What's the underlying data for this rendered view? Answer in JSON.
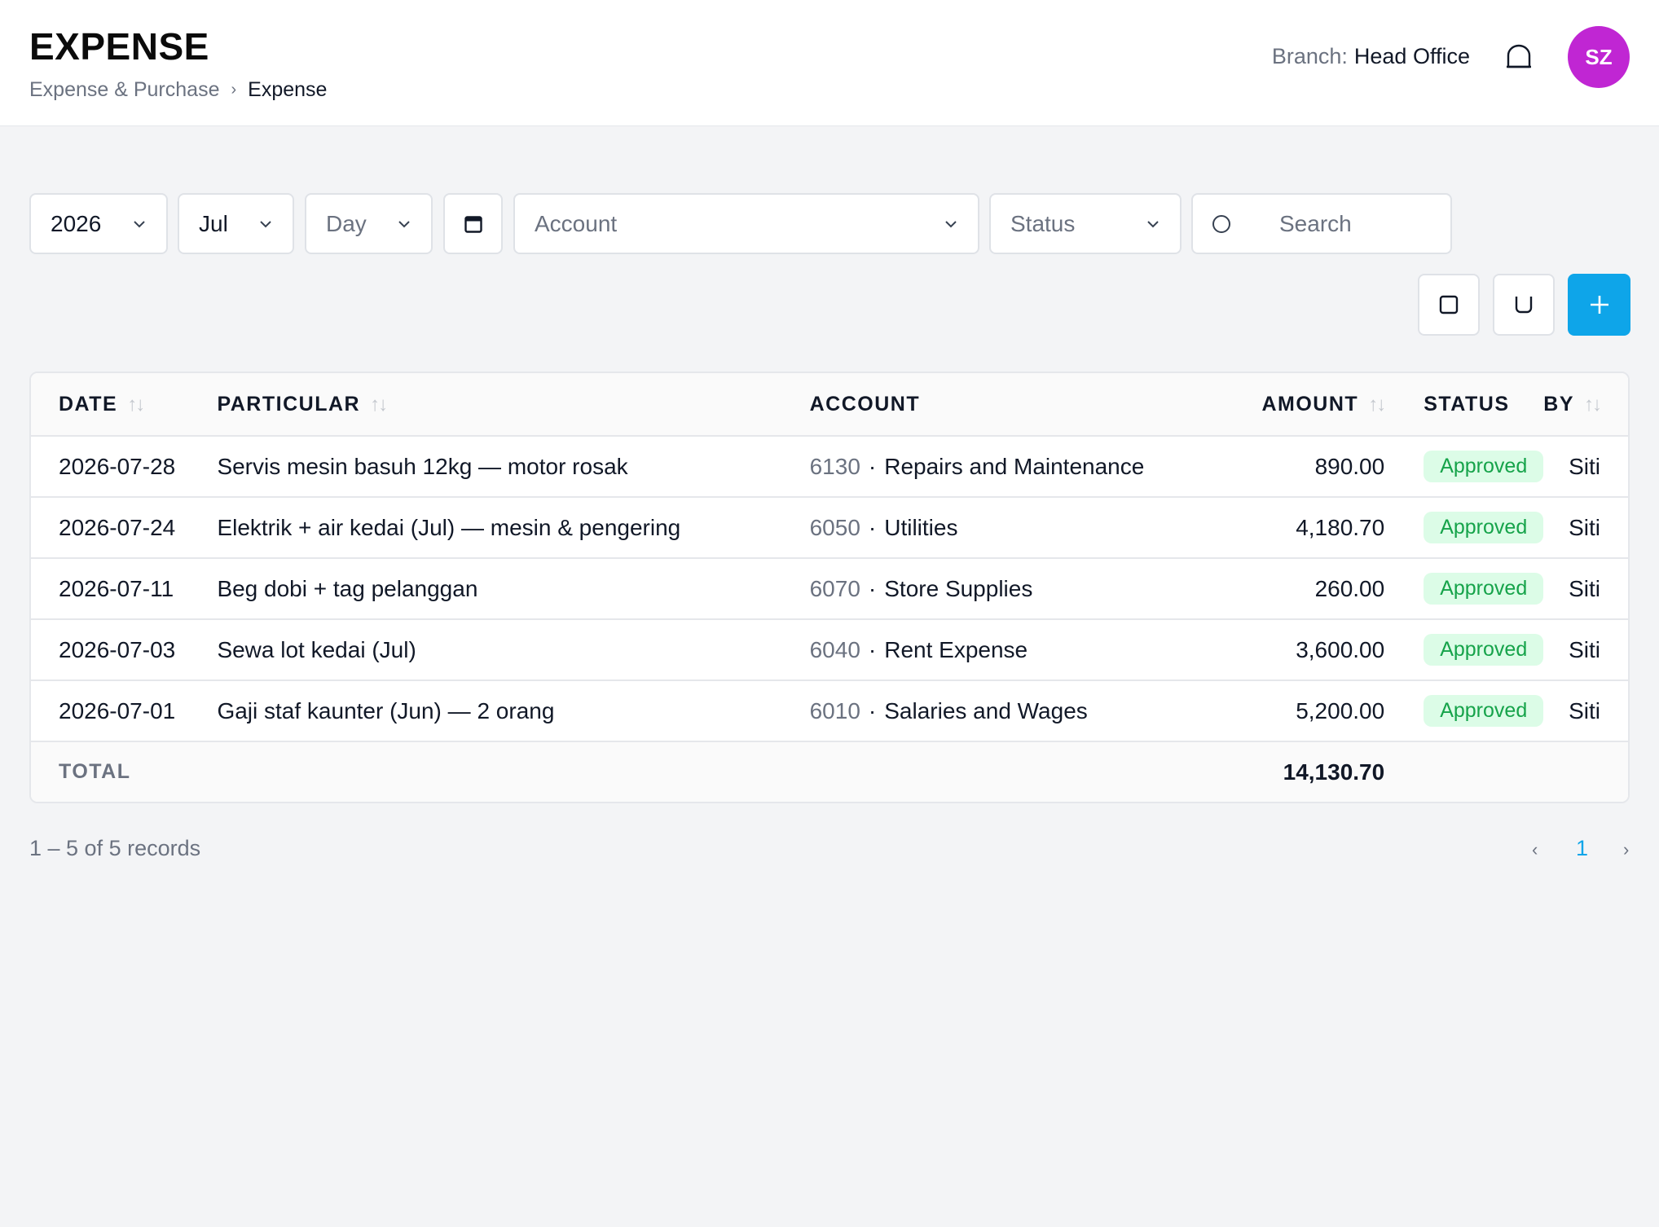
{
  "header": {
    "title": "EXPENSE",
    "breadcrumb": {
      "parent": "Expense & Purchase",
      "separator": "›",
      "current": "Expense"
    },
    "branch_label": "Branch:",
    "branch_name": "Head Office",
    "bell_icon": "bell-icon",
    "avatar_initials": "SZ",
    "avatar_color": "#c026d3"
  },
  "filters": {
    "year": "2026",
    "month": "Jul",
    "day_placeholder": "Day",
    "calendar_icon": "calendar-icon",
    "account_placeholder": "Account",
    "status_placeholder": "Status",
    "search_placeholder": "Search"
  },
  "actions": {
    "export_icon": "square-icon",
    "print_icon": "cup-icon",
    "add_icon": "plus-icon",
    "accent_color": "#0ea5e9"
  },
  "table": {
    "columns": {
      "date": "DATE",
      "particular": "PARTICULAR",
      "account": "ACCOUNT",
      "amount": "AMOUNT",
      "status": "STATUS",
      "by": "BY"
    },
    "sort_glyph": "↑↓",
    "rows": [
      {
        "date": "2026-07-28",
        "particular": "Servis mesin basuh 12kg — motor rosak",
        "account_code": "6130",
        "account_name": "Repairs and Maintenance",
        "amount": "890.00",
        "status": "Approved",
        "by": "Siti"
      },
      {
        "date": "2026-07-24",
        "particular": "Elektrik + air kedai (Jul) — mesin & pengering",
        "account_code": "6050",
        "account_name": "Utilities",
        "amount": "4,180.70",
        "status": "Approved",
        "by": "Siti"
      },
      {
        "date": "2026-07-11",
        "particular": "Beg dobi + tag pelanggan",
        "account_code": "6070",
        "account_name": "Store Supplies",
        "amount": "260.00",
        "status": "Approved",
        "by": "Siti"
      },
      {
        "date": "2026-07-03",
        "particular": "Sewa lot kedai (Jul)",
        "account_code": "6040",
        "account_name": "Rent Expense",
        "amount": "3,600.00",
        "status": "Approved",
        "by": "Siti"
      },
      {
        "date": "2026-07-01",
        "particular": "Gaji staf kaunter (Jun) — 2 orang",
        "account_code": "6010",
        "account_name": "Salaries and Wages",
        "amount": "5,200.00",
        "status": "Approved",
        "by": "Siti"
      }
    ],
    "account_separator": "·",
    "total_label": "TOTAL",
    "total_amount": "14,130.70",
    "status_color": "#16a34a"
  },
  "footer": {
    "records_text": "1 – 5 of 5 records",
    "prev": "‹",
    "page": "1",
    "next": "›"
  }
}
